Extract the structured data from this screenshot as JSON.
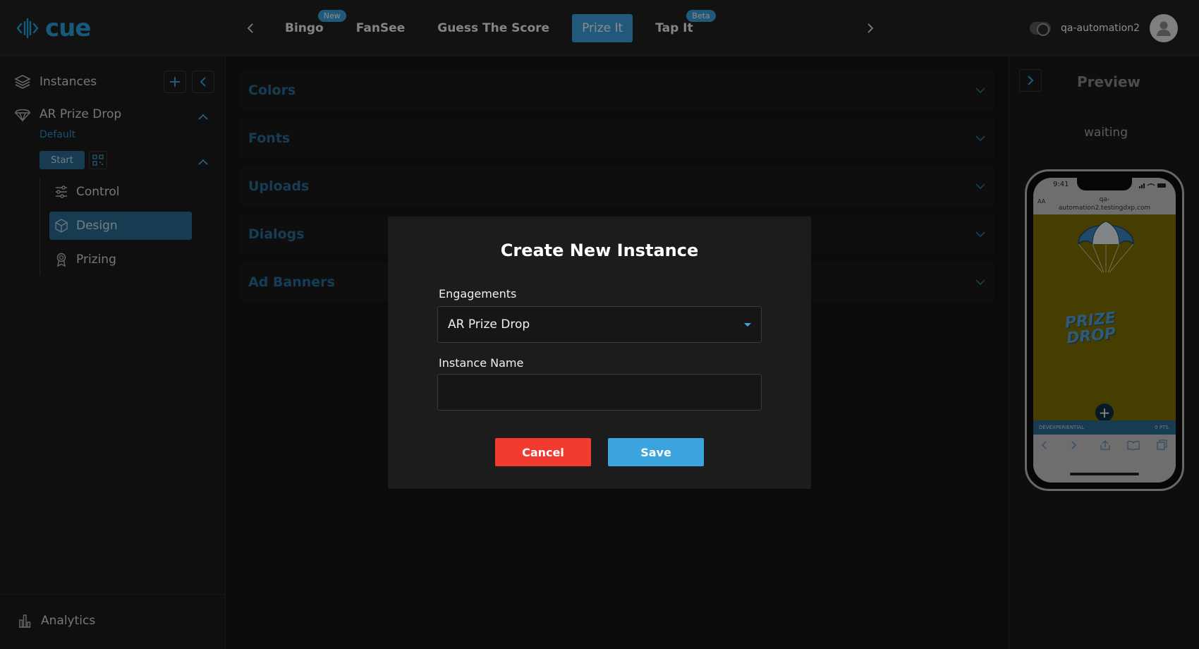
{
  "app": {
    "brand": "cue",
    "accent_color": "#3ba3de"
  },
  "topnav": {
    "tabs": [
      {
        "label": "Bingo",
        "badge": "New",
        "active": false
      },
      {
        "label": "FanSee",
        "badge": "",
        "active": false
      },
      {
        "label": "Guess The Score",
        "badge": "",
        "active": false
      },
      {
        "label": "Prize It",
        "badge": "",
        "active": true
      },
      {
        "label": "Tap It",
        "badge": "Beta",
        "active": false
      }
    ],
    "username": "qa-automation2"
  },
  "sidebar": {
    "instances_label": "Instances",
    "engagement": "AR Prize Drop",
    "instance": "Default",
    "start_label": "Start",
    "items": [
      {
        "label": "Control",
        "icon": "sliders-icon",
        "active": false
      },
      {
        "label": "Design",
        "icon": "cube-icon",
        "active": true
      },
      {
        "label": "Prizing",
        "icon": "award-icon",
        "active": false
      }
    ],
    "analytics_label": "Analytics"
  },
  "main": {
    "sections": [
      "Colors",
      "Fonts",
      "Uploads",
      "Dialogs",
      "Ad Banners"
    ]
  },
  "preview": {
    "title": "Preview",
    "status": "waiting",
    "phone": {
      "time": "9:41",
      "url_prefix": "AA",
      "url_line1": "qa-",
      "url_line2": "automation2.testingdxp.com",
      "game_title_line1": "PRIZE",
      "game_title_line2": "DROP",
      "bar_left": "DEVEXPERIENTIAL",
      "bar_right": "0 PTS."
    }
  },
  "modal": {
    "title": "Create New Instance",
    "engagements_label": "Engagements",
    "engagements_value": "AR Prize Drop",
    "instance_name_label": "Instance Name",
    "instance_name_value": "",
    "cancel_label": "Cancel",
    "save_label": "Save"
  }
}
